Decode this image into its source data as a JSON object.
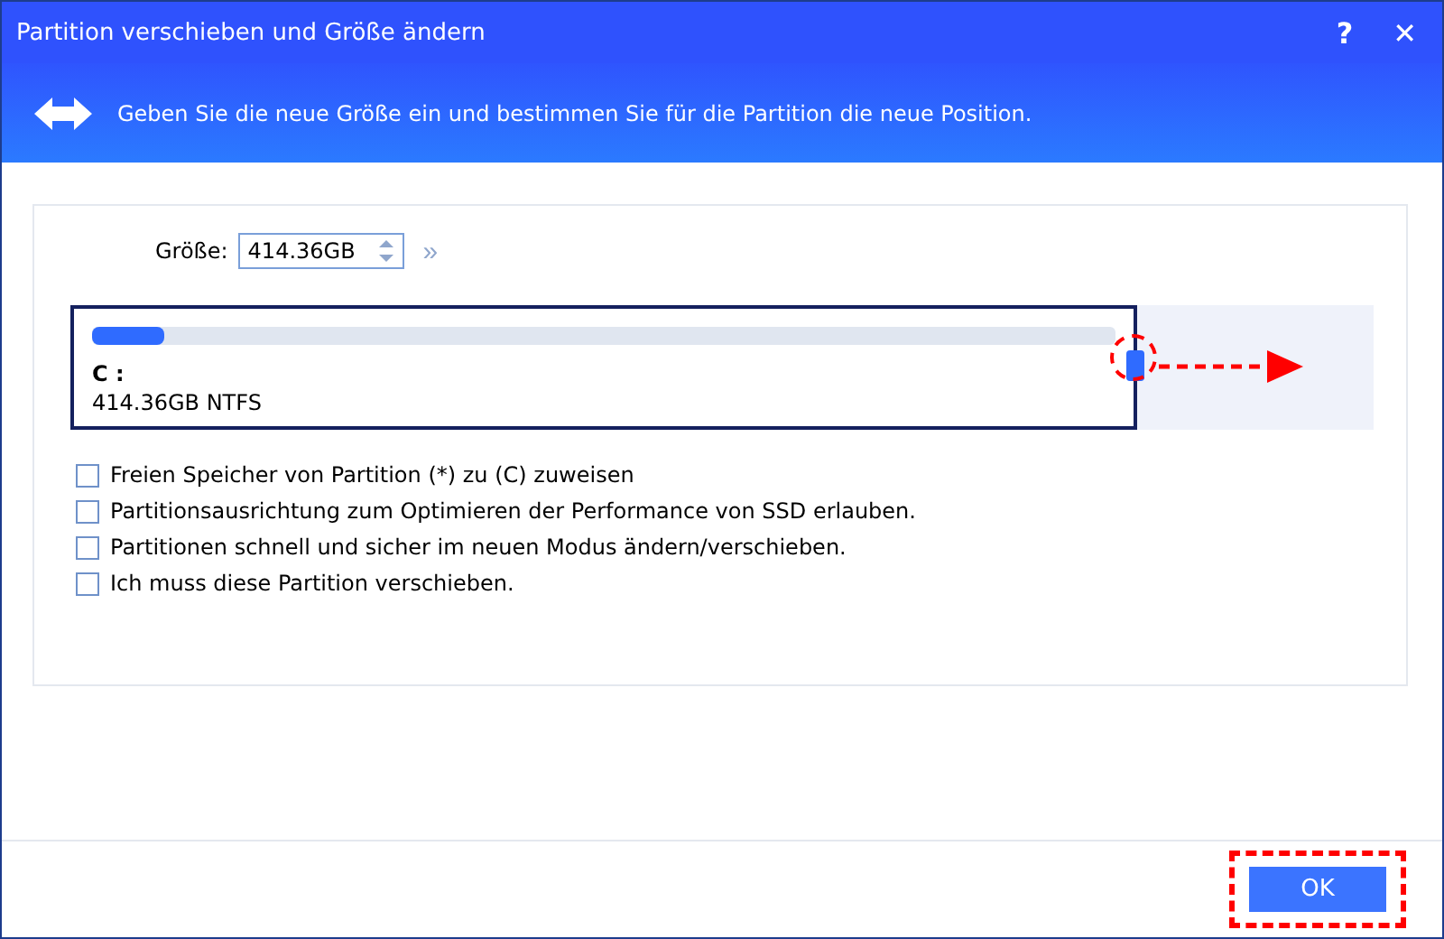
{
  "window": {
    "title": "Partition verschieben und Größe ändern",
    "help": "?",
    "close": "✕"
  },
  "header": {
    "text": "Geben Sie die neue Größe ein und bestimmen Sie für die Partition die neue Position."
  },
  "size": {
    "label": "Größe:",
    "value": "414.36GB",
    "expand": "»"
  },
  "partition": {
    "name": "C :",
    "info": "414.36GB NTFS",
    "usage": {
      "level": 0.07
    }
  },
  "options": [
    {
      "label": "Freien Speicher von Partition (*) zu (C) zuweisen",
      "checked": false
    },
    {
      "label": "Partitionsausrichtung zum Optimieren der Performance von SSD erlauben.",
      "checked": false
    },
    {
      "label": "Partitionen schnell und sicher im neuen Modus ändern/verschieben.",
      "checked": false
    },
    {
      "label": "Ich muss diese Partition verschieben.",
      "checked": false
    }
  ],
  "buttons": [
    {
      "label": "OK"
    }
  ]
}
